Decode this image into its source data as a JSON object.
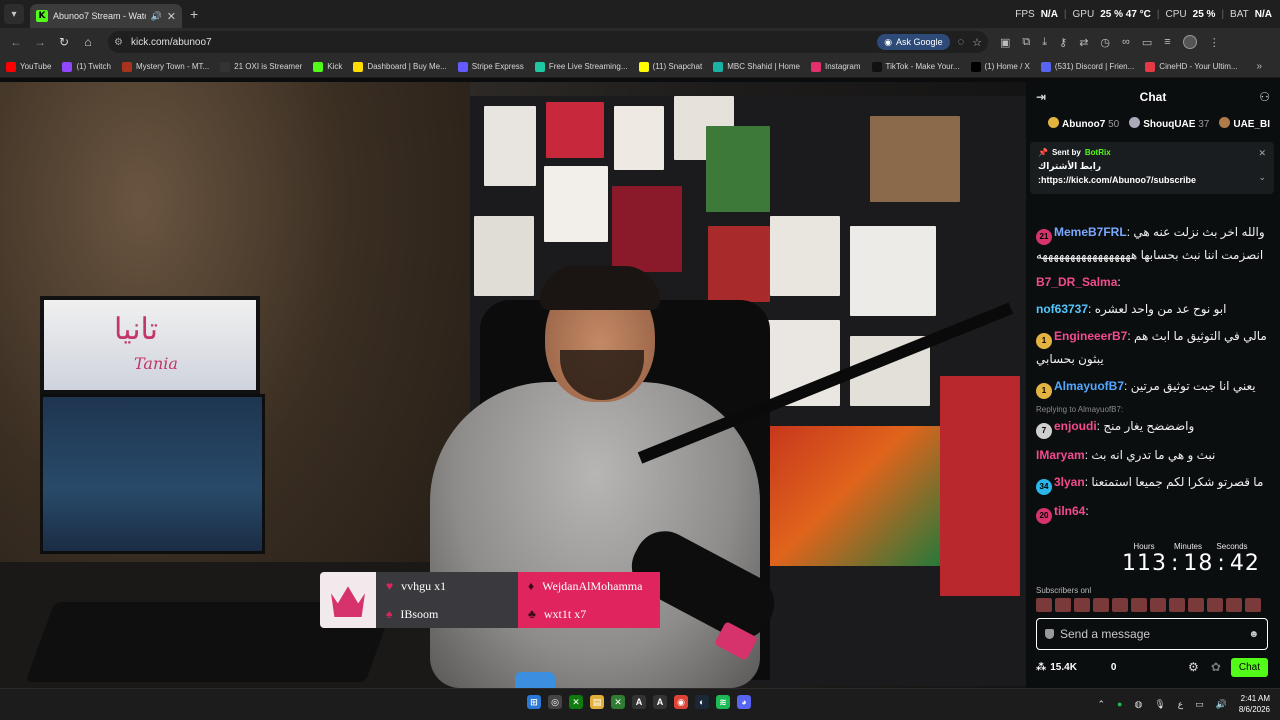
{
  "browser": {
    "tab": {
      "title": "Abunoo7 Stream - Watch L",
      "favicon_letter": "K"
    },
    "new_tab_label": "+",
    "perf": [
      {
        "label": "FPS",
        "value": "N/A"
      },
      {
        "label": "GPU",
        "value": "25 % 47 °C"
      },
      {
        "label": "CPU",
        "value": "25 %"
      },
      {
        "label": "BAT",
        "value": "N/A"
      }
    ],
    "url": "kick.com/abunoo7",
    "ask_google": "Ask Google"
  },
  "bookmarks": [
    {
      "label": "YouTube",
      "color": "#ff0000"
    },
    {
      "label": "(1) Twitch",
      "color": "#9146ff"
    },
    {
      "label": "Mystery Town - MT...",
      "color": "#a8321e"
    },
    {
      "label": "21 OXI is Streamer",
      "color": "#333333"
    },
    {
      "label": "Kick",
      "color": "#53fc18"
    },
    {
      "label": "Dashboard | Buy Me...",
      "color": "#ffdd00"
    },
    {
      "label": "Stripe Express",
      "color": "#635bff"
    },
    {
      "label": "Free Live Streaming...",
      "color": "#1ec8a0"
    },
    {
      "label": "(11) Snapchat",
      "color": "#fffc00"
    },
    {
      "label": "MBC Shahid | Home",
      "color": "#19b3a6"
    },
    {
      "label": "Instagram",
      "color": "#e1306c"
    },
    {
      "label": "TikTok - Make Your...",
      "color": "#111111"
    },
    {
      "label": "(1) Home / X",
      "color": "#000000"
    },
    {
      "label": "(531) Discord | Frien...",
      "color": "#5865f2"
    },
    {
      "label": "CineHD - Your Ultim...",
      "color": "#e63946"
    }
  ],
  "overlay": {
    "gifts_left": [
      "vvhgu x1",
      "IBsoom"
    ],
    "gifts_right": [
      "WejdanAlMohamma",
      "wxt1t x7"
    ]
  },
  "chat": {
    "title": "Chat",
    "leaderboard": [
      {
        "name": "Abunoo7",
        "points": "50"
      },
      {
        "name": "ShouqUAE",
        "points": "37"
      },
      {
        "name": "UAE_BI",
        "points": ""
      }
    ],
    "pinned": {
      "sent_by_label": "Sent by",
      "bot_name": "BotRix",
      "text": "رابط الأشتراك",
      "link": ":https://kick.com/Abunoo7/subscribe"
    },
    "messages": [
      {
        "badge": "21",
        "badge_color": "#d6336c",
        "user": "MemeB7FRL",
        "user_color": "#7aa8ff",
        "text": "والله اخر بث نزلت عنه هي انصزمت اننا نبث بحسابها هههههههههههههههههه"
      },
      {
        "badge": "",
        "badge_color": "",
        "user": "B7_DR_Salma",
        "user_color": "#f34b8e",
        "text": ""
      },
      {
        "badge": "",
        "badge_color": "",
        "user": "nof63737",
        "user_color": "#53c8ff",
        "text": "ابو نوح عد من واحد لعشره"
      },
      {
        "badge": "1",
        "badge_color": "#e3b341",
        "user": "EngineeerB7",
        "user_color": "#f34b8e",
        "text": "مالي في التوثيق ما ابث هم يبثون بحسابي"
      },
      {
        "badge": "1",
        "badge_color": "#e3b341",
        "user": "AlmayuofB7",
        "user_color": "#53a8ff",
        "text": "يعني انا جبت توثيق مرتين"
      },
      {
        "reply": "Replying to AlmayuofB7:",
        "badge": "7",
        "badge_color": "#cfcfcf",
        "user": "enjoudi",
        "user_color": "#f34b8e",
        "text": "واضضضح يغار منج"
      },
      {
        "badge": "",
        "badge_color": "",
        "user": "IMaryam",
        "user_color": "#f34b8e",
        "text": "نبث و هي ما تدري انه بث"
      },
      {
        "badge": "34",
        "badge_color": "#2bb5e8",
        "user": "3lyan",
        "user_color": "#f34b8e",
        "text": "ما قصرتو شكرا لكم جميعا استمتعنا"
      },
      {
        "badge": "20",
        "badge_color": "#d6336c",
        "user": "tiln64",
        "user_color": "#f34b8e",
        "text": ""
      }
    ],
    "timer": {
      "labels": [
        "Hours",
        "Minutes",
        "Seconds"
      ],
      "hours": "113",
      "minutes": "18",
      "seconds": "42"
    },
    "subscribers_label": "Subscribers onl",
    "composer_placeholder": "Send a message",
    "kicks_count": "15.4K",
    "zero_count": "0",
    "send_label": "Chat"
  },
  "taskbar": {
    "time": "2:41 AM",
    "date": "8/6/2026",
    "lang": "ع"
  }
}
